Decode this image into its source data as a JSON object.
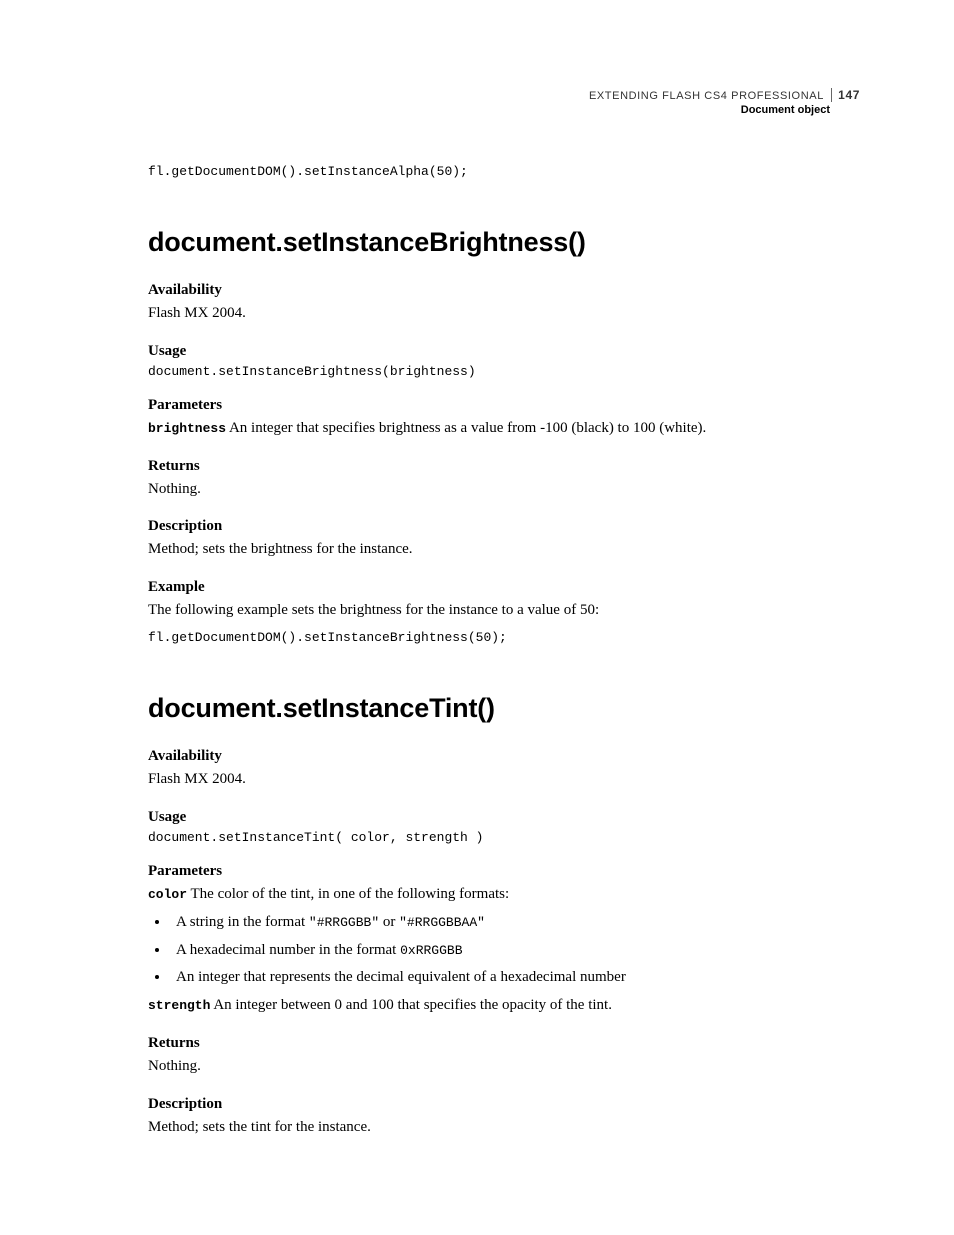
{
  "header": {
    "book_title": "EXTENDING FLASH CS4 PROFESSIONAL",
    "page_number": "147",
    "chapter": "Document object"
  },
  "pre_code": "fl.getDocumentDOM().setInstanceAlpha(50);",
  "section1": {
    "title": "document.setInstanceBrightness()",
    "availability_label": "Availability",
    "availability_text": "Flash MX 2004.",
    "usage_label": "Usage",
    "usage_code": "document.setInstanceBrightness(brightness)",
    "parameters_label": "Parameters",
    "param_name": "brightness",
    "param_desc": "  An integer that specifies brightness as a value from -100 (black) to 100 (white).",
    "returns_label": "Returns",
    "returns_text": "Nothing.",
    "description_label": "Description",
    "description_text": "Method; sets the brightness for the instance.",
    "example_label": "Example",
    "example_text": "The following example sets the brightness for the instance to a value of 50:",
    "example_code": "fl.getDocumentDOM().setInstanceBrightness(50);"
  },
  "section2": {
    "title": "document.setInstanceTint()",
    "availability_label": "Availability",
    "availability_text": "Flash MX 2004.",
    "usage_label": "Usage",
    "usage_code": "document.setInstanceTint( color, strength )",
    "parameters_label": "Parameters",
    "param1_name": "color",
    "param1_desc": "  The color of the tint, in one of the following formats:",
    "bullet1_a": "A string in the format ",
    "bullet1_code1": "\"#RRGGBB\"",
    "bullet1_b": " or ",
    "bullet1_code2": "\"#RRGGBBAA\"",
    "bullet2_a": "A hexadecimal number in the format ",
    "bullet2_code": "0xRRGGBB",
    "bullet3": "An integer that represents the decimal equivalent of a hexadecimal number",
    "param2_name": "strength",
    "param2_desc": "  An integer between 0 and 100 that specifies the opacity of the tint.",
    "returns_label": "Returns",
    "returns_text": "Nothing.",
    "description_label": "Description",
    "description_text": "Method; sets the tint for the instance."
  }
}
